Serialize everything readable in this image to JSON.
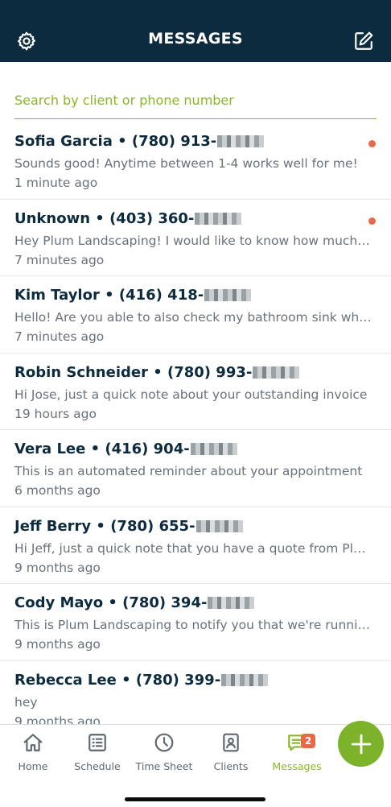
{
  "header": {
    "title": "MESSAGES",
    "left_icon": "gear-icon",
    "right_icon": "compose-icon"
  },
  "search": {
    "placeholder": "Search by client or phone number",
    "value": ""
  },
  "messages": [
    {
      "name": "Sofia Garcia • (780) 913-",
      "preview": "Sounds good! Anytime between 1-4 works well for me!",
      "time": "1 minute ago",
      "unread": true
    },
    {
      "name": "Unknown • (403) 360-",
      "preview": "Hey Plum Landscaping! I would like to know how much it would cost",
      "time": "7 minutes ago",
      "unread": true
    },
    {
      "name": "Kim Taylor • (416) 418-",
      "preview": "Hello! Are you able to also check my bathroom sink while you're here",
      "time": "7 minutes ago",
      "unread": false
    },
    {
      "name": "Robin Schneider • (780) 993-",
      "preview": "Hi Jose, just a quick note about your outstanding invoice",
      "time": "19 hours ago",
      "unread": false
    },
    {
      "name": "Vera Lee • (416) 904-",
      "preview": "This is an automated reminder about your appointment",
      "time": "6 months ago",
      "unread": false
    },
    {
      "name": "Jeff Berry • (780) 655-",
      "preview": "Hi Jeff, just a quick note that you have a quote from Plum Landscaping",
      "time": "9 months ago",
      "unread": false
    },
    {
      "name": "Cody Mayo • (780) 394-",
      "preview": "This is Plum Landscaping to notify you that we're running late",
      "time": "9 months ago",
      "unread": false
    },
    {
      "name": "Rebecca Lee • (780) 399-",
      "preview": "hey",
      "time": "9 months ago",
      "unread": false
    }
  ],
  "tabs": [
    {
      "label": "Home",
      "icon": "home-icon"
    },
    {
      "label": "Schedule",
      "icon": "schedule-icon"
    },
    {
      "label": "Time Sheet",
      "icon": "clock-icon"
    },
    {
      "label": "Clients",
      "icon": "clients-icon"
    },
    {
      "label": "Messages",
      "icon": "messages-icon",
      "badge": "2",
      "active": true
    }
  ],
  "fab": {
    "icon": "plus-icon"
  },
  "colors": {
    "header_bg": "#0d2b3e",
    "accent_green": "#8bb52b",
    "unread_dot": "#e8694a",
    "text_dark": "#0d2b3e",
    "text_muted": "#68727a"
  }
}
